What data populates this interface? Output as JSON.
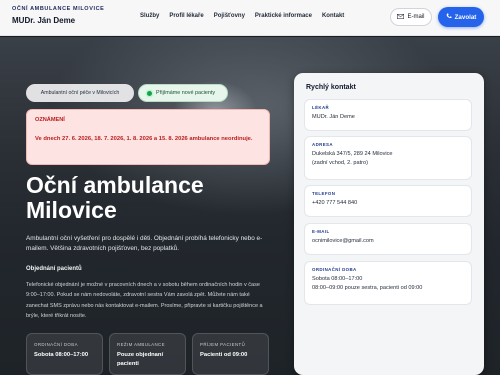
{
  "header": {
    "kicker": "Oční ambulance Milovice",
    "brand": "MUDr. Ján Deme",
    "nav": [
      "Služby",
      "Profil lékaře",
      "Pojišťovny",
      "Praktické informace",
      "Kontakt"
    ],
    "email_label": "E-mail",
    "call_label": "Zavolat",
    "accent": "#2563eb"
  },
  "hero": {
    "location_chip": "Ambulantní oční péče v Milovicích",
    "status_chip": "Přijímáme nové pacienty",
    "notice": {
      "title": "OZNÁMENÍ",
      "text": "Ve dnech 27. 6. 2026, 18. 7. 2026, 1. 8. 2026 a 15. 8. 2026 ambulance neordinuje."
    },
    "title": "Oční ambulance Milovice",
    "subtitle": "Ambulantní oční vyšetření pro dospělé i děti. Objednání probíhá telefonicky nebo e-mailem. Většina zdravotních pojišťoven, bez poplatků.",
    "ordering_heading": "Objednání pacientů",
    "ordering_text": "Telefonické objednání je možné v pracovních dnech a v sobotu během ordinačních hodin v čase 9:00–17:00. Pokud se nám nedovoláte, zdravotní sestra Vám zavolá zpět. Můžete nám také zanechat SMS zprávu nebo nás kontaktovat e-mailem. Prosíme, připravte si kartičku pojištěnce a brýle, které třikrát nosíte.",
    "cards": [
      {
        "label": "Ordinační doba",
        "value": "Sobota 08:00–17:00"
      },
      {
        "label": "Režim ambulance",
        "value": "Pouze objednaní pacienti"
      },
      {
        "label": "Příjem pacientů",
        "value": "Pacienti od 09:00"
      }
    ]
  },
  "contact": {
    "title": "Rychlý kontakt",
    "items": [
      {
        "label": "Lékař",
        "lines": [
          "MUDr. Ján Deme"
        ]
      },
      {
        "label": "Adresa",
        "lines": [
          "Dukelská 347/5, 289 24 Milovice",
          "(zadní vchod, 2. patro)"
        ]
      },
      {
        "label": "Telefon",
        "lines": [
          "+420 777 544 840"
        ]
      },
      {
        "label": "E-mail",
        "lines": [
          "ocnimilovice@gmail.com"
        ]
      },
      {
        "label": "Ordinační doba",
        "lines": [
          "Sobota 08:00–17:00",
          "08:00–09:00 pouze sestra, pacienti od 09:00"
        ]
      }
    ]
  },
  "icons": {
    "email": "envelope-icon",
    "call": "phone-icon",
    "status": "green-dot-icon"
  }
}
